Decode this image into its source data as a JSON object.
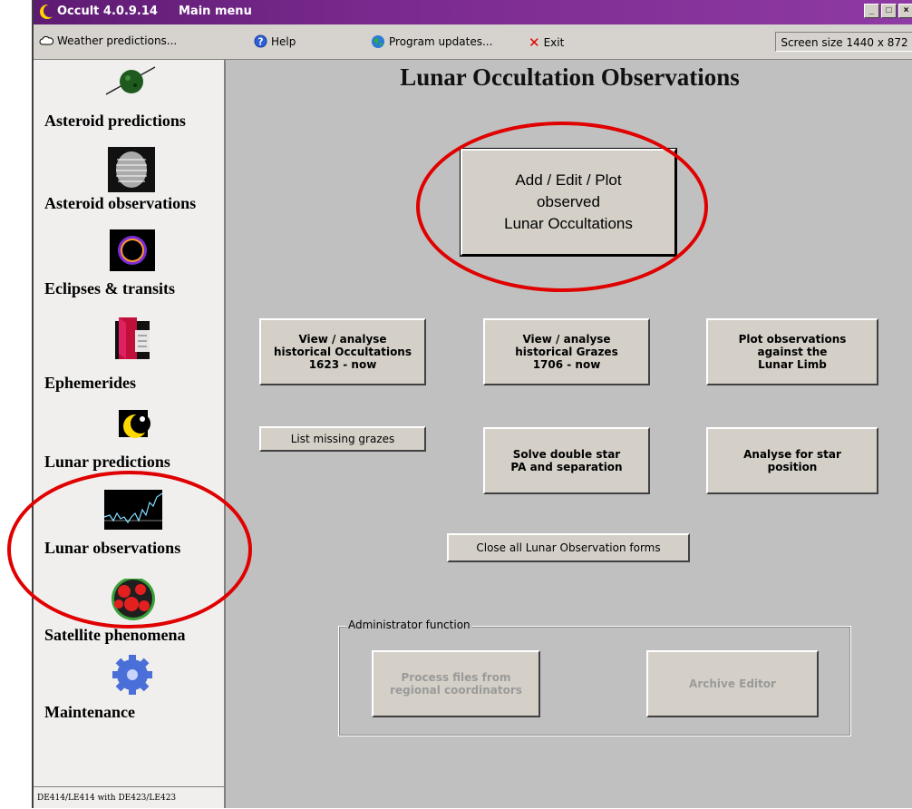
{
  "titlebar": {
    "app_title": "Occult 4.0.9.14",
    "window_title": "Main menu"
  },
  "menubar": {
    "weather": "Weather predictions...",
    "help": "Help",
    "updates": "Program updates...",
    "exit": "Exit",
    "screen_size": "Screen size 1440 x 872"
  },
  "sidebar": {
    "items": [
      {
        "label": "Asteroid predictions",
        "icon": "asteroid-icon"
      },
      {
        "label": "Asteroid observations",
        "icon": "asteroid-occultation-icon"
      },
      {
        "label": "Eclipses & transits",
        "icon": "eclipse-icon"
      },
      {
        "label": "Ephemerides",
        "icon": "book-icon"
      },
      {
        "label": "Lunar predictions",
        "icon": "moon-icon"
      },
      {
        "label": "Lunar observations",
        "icon": "lightcurve-icon"
      },
      {
        "label": "Satellite phenomena",
        "icon": "jupiter-icon"
      },
      {
        "label": "Maintenance",
        "icon": "gear-icon"
      }
    ],
    "status": "DE414/LE414 with DE423/LE423"
  },
  "main": {
    "heading": "Lunar Occultation Observations",
    "add_edit_plot": "Add / Edit / Plot\nobserved\nLunar Occultations",
    "view_occultations": "View / analyse\nhistorical Occultations\n1623 - now",
    "view_grazes": "View / analyse\nhistorical Grazes\n1706 - now",
    "plot_limb": "Plot observations\nagainst the\nLunar Limb",
    "list_missing": "List missing grazes",
    "solve_double": "Solve double star\nPA and separation",
    "analyse_star": "Analyse for star\nposition",
    "close_forms": "Close all Lunar Observation forms",
    "admin": {
      "legend": "Administrator function",
      "process_files": "Process files from\nregional coordinators",
      "archive_editor": "Archive Editor"
    }
  },
  "colors": {
    "title_bar": "#6a2280",
    "highlight_ring": "#e00000",
    "panel": "#c0c0c0"
  }
}
